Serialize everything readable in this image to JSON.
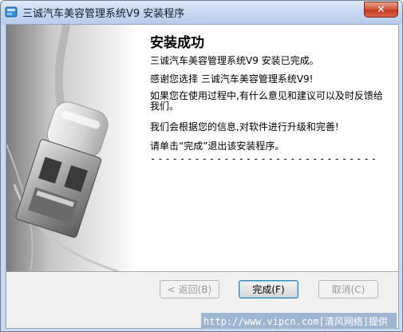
{
  "window": {
    "title": "三诚汽车美容管理系统V9 安装程序",
    "close_label": "✕"
  },
  "content": {
    "heading": "安装成功",
    "line1": "三诚汽车美容管理系统V9   安装已完成。",
    "line2": "感谢您选择 三诚汽车美容管理系统V9!",
    "line3": "如果您在使用过程中,有什么意见和建议可以及时反馈给我们。",
    "line4": "我们会根据您的信息,对软件进行升级和完善!",
    "line5": "请单击“完成”退出该安装程序。",
    "dashes": "-------------------------------"
  },
  "buttons": {
    "back": "< 返回(B)",
    "finish": "完成(F)",
    "cancel": "取消(C)"
  },
  "watermark": "http://www.vipcn.com[清风网络]提供",
  "icons": {
    "app": "installer-icon",
    "close": "close-icon",
    "banner": "usb-plug-image"
  }
}
